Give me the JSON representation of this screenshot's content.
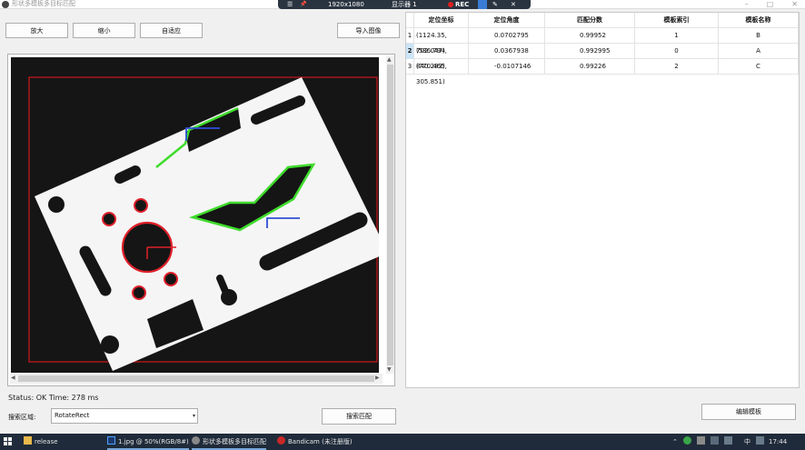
{
  "window": {
    "title": "形状多模板多目标匹配",
    "minimize": "–",
    "maximize": "□",
    "close": "✕"
  },
  "recorder": {
    "menu_icon": "☰",
    "pin_icon": "📌",
    "resolution": "1920x1080",
    "monitor": "显示器 1",
    "rec": "REC",
    "pencil": "✎",
    "close": "✕"
  },
  "toolbar": {
    "zoom_in": "放大",
    "zoom_out": "缩小",
    "fit": "自适应",
    "import": "导入图像"
  },
  "table": {
    "columns": [
      "定位坐标",
      "定位角度",
      "匹配分数",
      "模板索引",
      "模板名称"
    ],
    "rows": [
      {
        "id": "1",
        "coord": "(1124.35, 702.047)",
        "angle": "0.0702795",
        "score": "0.99952",
        "index": "1",
        "name": "B"
      },
      {
        "id": "2",
        "coord": "(586.794, 840.283)",
        "angle": "0.0367938",
        "score": "0.992995",
        "index": "0",
        "name": "A"
      },
      {
        "id": "3",
        "coord": "(770.465, 305.851)",
        "angle": "-0.0107146",
        "score": "0.99226",
        "index": "2",
        "name": "C"
      }
    ]
  },
  "status": "Status: OK Time: 278 ms",
  "search": {
    "label": "搜索区域:",
    "selected": "RotateRect",
    "button": "搜索匹配"
  },
  "edit_template": "编辑模板",
  "taskbar": {
    "items": [
      "release",
      "1.jpg @ 50%(RGB/8#)",
      "形状多模板多目标匹配",
      "Bandicam (未注册版)"
    ],
    "ime": "中",
    "time": "17:44"
  },
  "colors": {
    "match_green": "#3fdc2c",
    "match_red": "#e0202a",
    "axis_blue": "#2f4fd8",
    "roi_red": "#c0181c",
    "part_white": "#f5f5f5"
  }
}
